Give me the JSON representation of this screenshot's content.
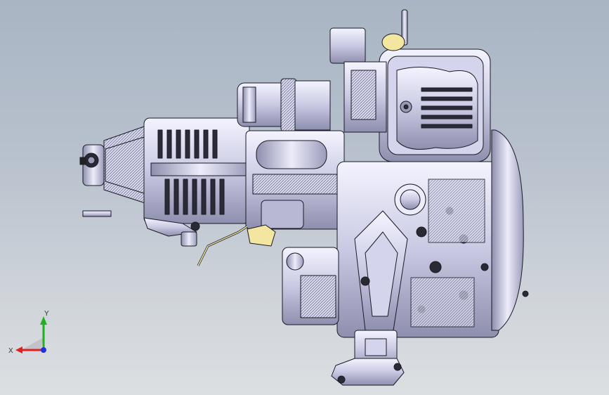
{
  "viewport": {
    "background_top": "#a9b5c4",
    "background_bottom": "#dcdfe2"
  },
  "model": {
    "line_color": "#1a1a24",
    "body_fill": "#dcdcf0",
    "shade_fill": "#9a9ab8",
    "accent_fill": "#f2e6a0"
  },
  "triad": {
    "x_label": "X",
    "y_label": "Y",
    "x_color": "#e02020",
    "y_color": "#20b020",
    "z_color": "#2030e0"
  }
}
